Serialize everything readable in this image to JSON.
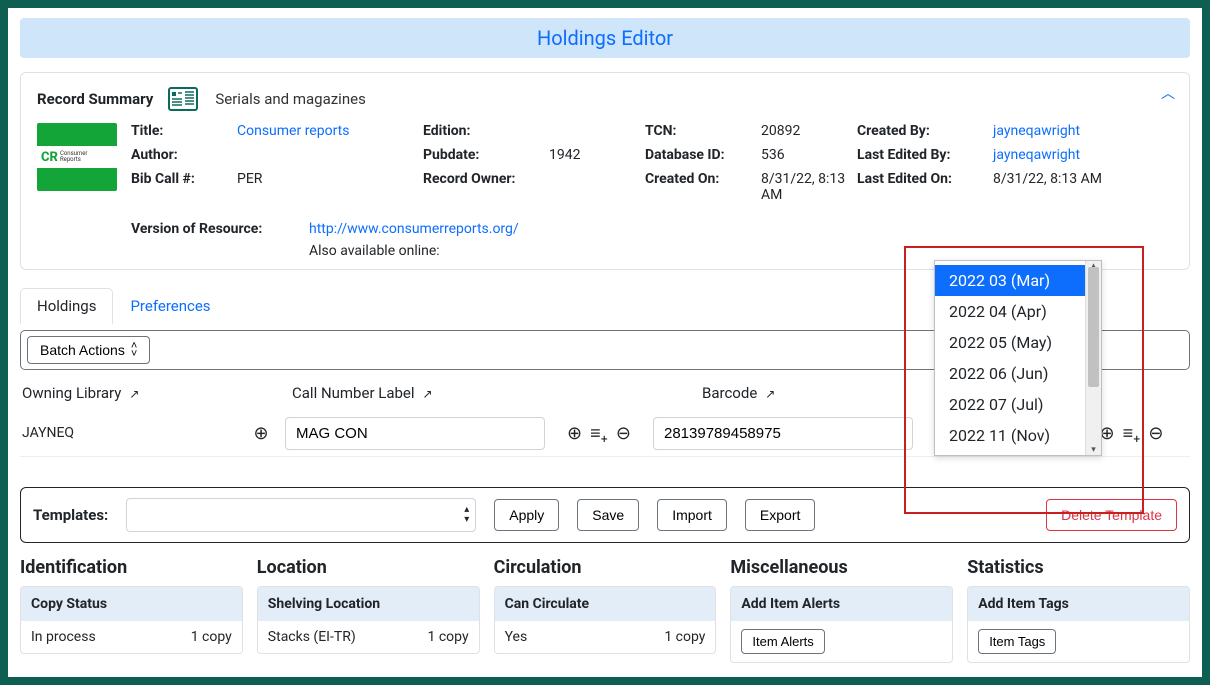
{
  "banner": {
    "title": "Holdings Editor"
  },
  "summary": {
    "heading": "Record Summary",
    "format": "Serials and magazines",
    "title_lbl": "Title:",
    "title_val": "Consumer reports",
    "author_lbl": "Author:",
    "author_val": "",
    "call_lbl": "Bib Call #:",
    "call_val": "PER",
    "edition_lbl": "Edition:",
    "edition_val": "",
    "pubdate_lbl": "Pubdate:",
    "pubdate_val": "1942",
    "owner_lbl": "Record Owner:",
    "owner_val": "",
    "tcn_lbl": "TCN:",
    "tcn_val": "20892",
    "db_lbl": "Database ID:",
    "db_val": "536",
    "createdon_lbl": "Created On:",
    "createdon_val": "8/31/22, 8:13 AM",
    "createdby_lbl": "Created By:",
    "createdby_val": "jayneqawright",
    "editby_lbl": "Last Edited By:",
    "editby_val": "jayneqawright",
    "editon_lbl": "Last Edited On:",
    "editon_val": "8/31/22, 8:13 AM",
    "ver_lbl": "Version of Resource:",
    "ver_url": "http://www.consumerreports.org/",
    "ver_note": "Also available online:"
  },
  "tabs": {
    "holdings": "Holdings",
    "prefs": "Preferences"
  },
  "batch": {
    "label": "Batch Actions"
  },
  "columns": {
    "owning": "Owning Library",
    "calln": "Call Number Label",
    "barcode": "Barcode"
  },
  "row": {
    "owning": "JAYNEQ",
    "calln": "MAG CON",
    "barcode": "28139789458975",
    "part": ""
  },
  "dropdown": {
    "items": [
      "2022 03 (Mar)",
      "2022 04 (Apr)",
      "2022 05 (May)",
      "2022 06 (Jun)",
      "2022 07 (Jul)",
      "2022 11 (Nov)"
    ],
    "selected_index": 0
  },
  "templates": {
    "label": "Templates:",
    "apply": "Apply",
    "save": "Save",
    "import": "Import",
    "export": "Export",
    "delete": "Delete Template"
  },
  "sections": {
    "identification": {
      "title": "Identification",
      "card_head": "Copy Status",
      "body_left": "In process",
      "body_right": "1 copy"
    },
    "location": {
      "title": "Location",
      "card_head": "Shelving Location",
      "body_left": "Stacks (EI-TR)",
      "body_right": "1 copy"
    },
    "circulation": {
      "title": "Circulation",
      "card_head": "Can Circulate",
      "body_left": "Yes",
      "body_right": "1 copy"
    },
    "misc": {
      "title": "Miscellaneous",
      "card_head": "Add Item Alerts",
      "btn": "Item Alerts"
    },
    "stats": {
      "title": "Statistics",
      "card_head": "Add Item Tags",
      "btn": "Item Tags"
    }
  }
}
